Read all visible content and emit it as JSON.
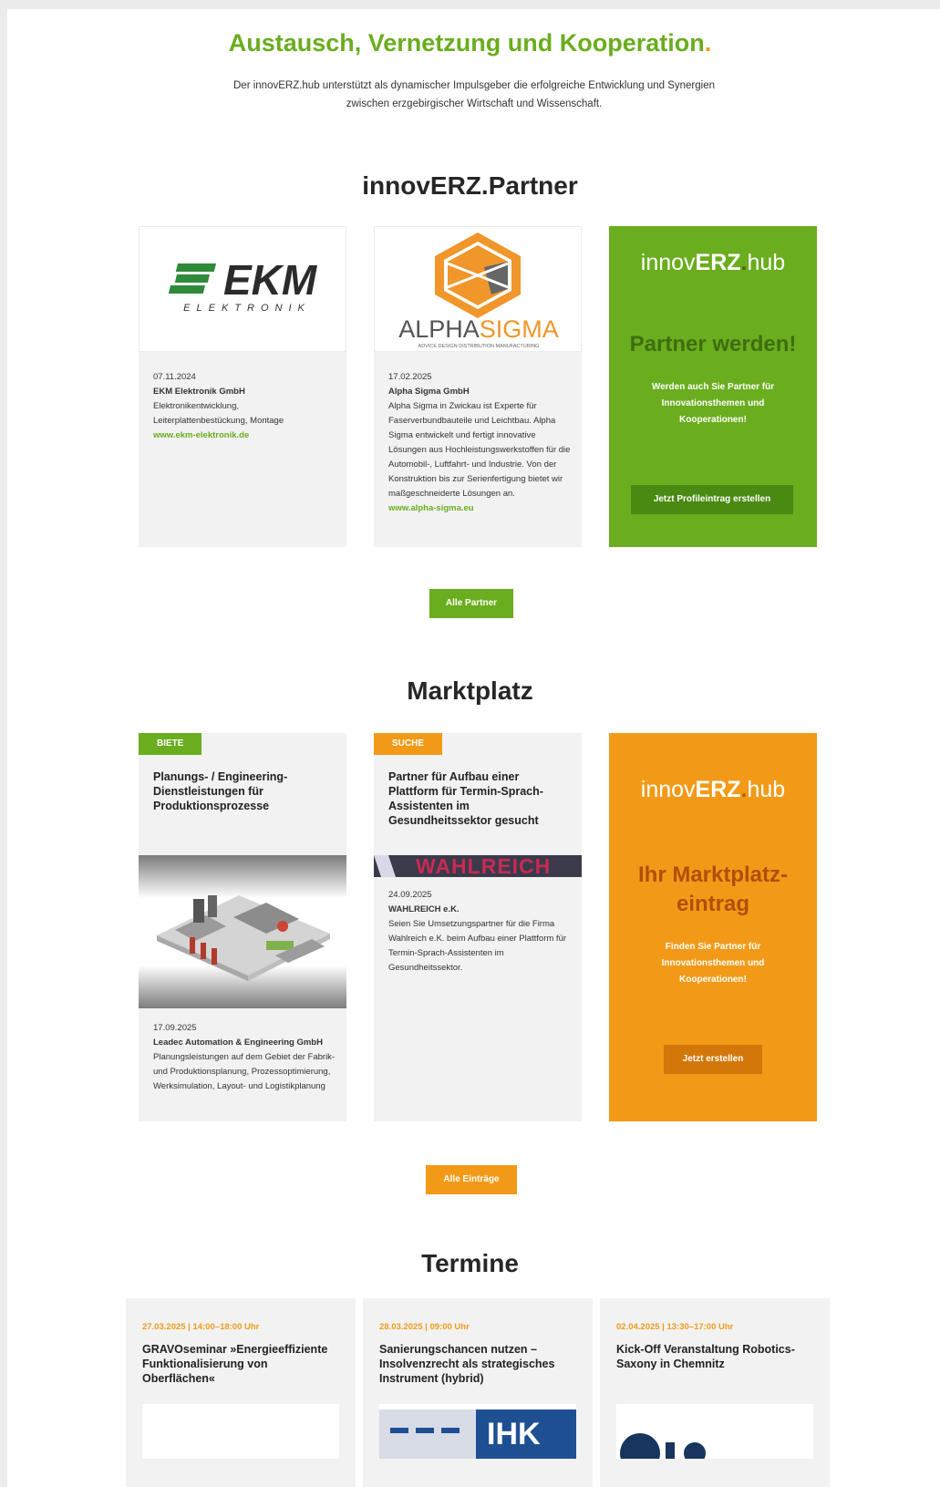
{
  "hero": {
    "title": "Austausch, Vernetzung und Kooperation",
    "dot": ".",
    "subtitle": "Der innovERZ.hub unterstützt als dynamischer Impulsgeber die erfolgreiche Entwicklung und Synergien zwischen erzgebirgischer Wirtschaft und Wissenschaft."
  },
  "partner": {
    "section_title": "innovERZ.Partner",
    "cards": [
      {
        "logo_text": "EKM",
        "logo_sub": "ELEKTRONIK",
        "date": "07.11.2024",
        "company": "EKM Elektronik GmbH",
        "desc": "Elektronikentwicklung, Leiterplattenbestückung, Montage",
        "link": "www.ekm-elektronik.de"
      },
      {
        "logo_text_a": "ALPHA",
        "logo_text_b": "SIGMA",
        "logo_sub": "ADVICE DESIGN DISTRIBUTION MANUFACTURING",
        "date": "17.02.2025",
        "company": "Alpha Sigma GmbH",
        "desc": "Alpha Sigma in Zwickau ist Experte für Faserverbundbauteile und Leichtbau. Alpha Sigma entwickelt und fertigt innovative Lösungen aus Hochleistungswerkstoffen für die Automobil-, Luftfahrt- und Industrie. Von der Konstruktion bis zur Serienfertigung bietet wir maßgeschneiderte Lösungen an.",
        "link": "www.alpha-sigma.eu"
      }
    ],
    "promo": {
      "brand_a": "innov",
      "brand_b": "ERZ",
      "brand_dot": ".",
      "brand_c": "hub",
      "heading": "Partner werden!",
      "text": "Werden auch Sie Partner für Innovationsthemen und Kooperationen!",
      "button": "Jetzt Profileintrag erstellen"
    },
    "all_button": "Alle Partner"
  },
  "market": {
    "section_title": "Marktplatz",
    "cards": [
      {
        "badge": "BIETE",
        "title": "Planungs- / Engineering-Dienstleistungen für Produktionsprozesse",
        "date": "17.09.2025",
        "company": "Leadec Automation & Engineering GmbH",
        "desc": "Planungsleistungen auf dem Gebiet der Fabrik- und Produktionsplanung, Prozessoptimierung, Werksimulation, Layout- und Logistikplanung"
      },
      {
        "badge": "SUCHE",
        "title": "Partner für Aufbau einer Plattform für Termin-Sprach-Assistenten im Gesundheitssektor gesucht",
        "banner_text": "WAHLREICH",
        "date": "24.09.2025",
        "company": "WAHLREICH e.K.",
        "desc": "Seien Sie Umsetzungspartner für die Firma Wahlreich e.K. beim Aufbau einer Plattform für Termin-Sprach-Assistenten im Gesundheitssektor."
      }
    ],
    "promo": {
      "brand_a": "innov",
      "brand_b": "ERZ",
      "brand_dot": ".",
      "brand_c": "hub",
      "heading": "Ihr Marktplatz-eintrag",
      "text": "Finden Sie Partner für Innovationsthemen und Kooperationen!",
      "button": "Jetzt erstellen"
    },
    "all_button": "Alle Einträge"
  },
  "events": {
    "section_title": "Termine",
    "cards": [
      {
        "date": "27.03.2025 | 14:00–18:00 Uhr",
        "title": "GRAVOseminar »Energieeffiziente Funktionalisierung von Oberflächen«"
      },
      {
        "date": "28.03.2025 | 09:00 Uhr",
        "title": "Sanierungschancen nutzen – Insolvenzrecht als strategisches Instrument (hybrid)",
        "image_text": "IHK"
      },
      {
        "date": "02.04.2025 | 13:30–17:00 Uhr",
        "title": "Kick-Off Veranstaltung Robotics-Saxony in Chemnitz"
      }
    ]
  },
  "colors": {
    "green": "#6aad1e",
    "orange": "#f29a17",
    "dark_green": "#4a8a12",
    "dark_orange": "#d4770a"
  }
}
